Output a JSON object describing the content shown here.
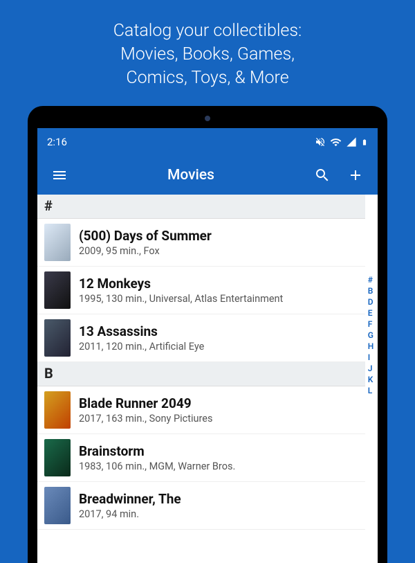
{
  "promo": {
    "line1": "Catalog your collectibles:",
    "line2": "Movies, Books, Games,",
    "line3": "Comics, Toys, & More"
  },
  "status": {
    "time": "2:16"
  },
  "appbar": {
    "title": "Movies"
  },
  "sections": [
    {
      "letter": "#",
      "items": [
        {
          "title": "(500) Days of Summer",
          "sub": "2009, 95 min., Fox",
          "thumb": "c0"
        },
        {
          "title": "12 Monkeys",
          "sub": "1995, 130 min., Universal, Atlas Entertainment",
          "thumb": "c1"
        },
        {
          "title": "13 Assassins",
          "sub": "2011, 120 min., Artificial Eye",
          "thumb": "c2"
        }
      ]
    },
    {
      "letter": "B",
      "items": [
        {
          "title": "Blade Runner 2049",
          "sub": "2017, 163 min., Sony Pictiures",
          "thumb": "c3"
        },
        {
          "title": "Brainstorm",
          "sub": "1983, 106 min., MGM, Warner Bros.",
          "thumb": "c4"
        },
        {
          "title": "Breadwinner, The",
          "sub": "2017, 94 min.",
          "thumb": "c5"
        }
      ]
    }
  ],
  "index_rail": [
    "#",
    "B",
    "D",
    "E",
    "F",
    "G",
    "H",
    "I",
    "J",
    "K",
    "L"
  ]
}
